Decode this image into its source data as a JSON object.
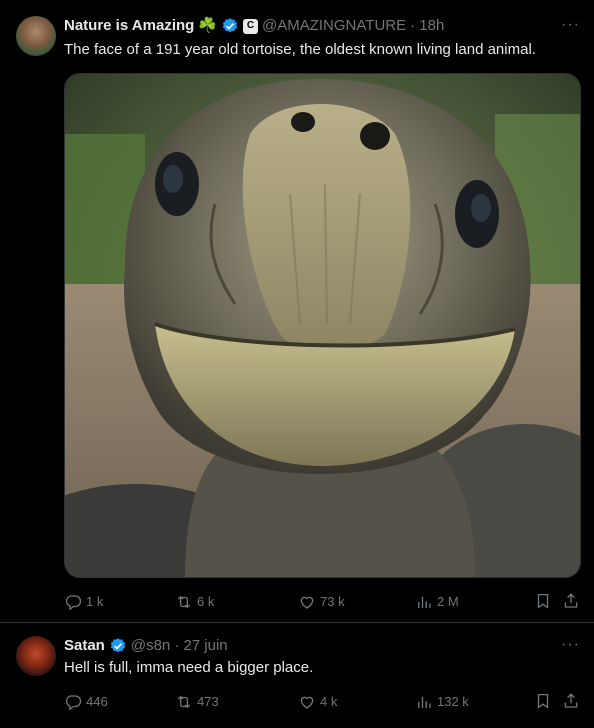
{
  "tweets": [
    {
      "name": "Nature is Amazing",
      "emoji": "☘️",
      "affiliate_badge": "C",
      "handle": "@AMAZINGNATURE",
      "time": "· 18h",
      "text": "The face of a 191 year old tortoise, the oldest known living land animal.",
      "stats": {
        "replies": "1 k",
        "retweets": "6 k",
        "likes": "73 k",
        "views": "2 M"
      }
    },
    {
      "name": "Satan",
      "handle": "@s8n",
      "time": "· 27 juin",
      "text": "Hell is full, imma need a bigger place.",
      "stats": {
        "replies": "446",
        "retweets": "473",
        "likes": "4 k",
        "views": "132 k"
      }
    }
  ],
  "more_label": "···",
  "colors": {
    "background": "#000000",
    "text": "#e7e9ea",
    "muted": "#71767b",
    "verified": "#1d9bf0",
    "border": "#2f3336"
  },
  "icons": [
    "reply-icon",
    "retweet-icon",
    "like-icon",
    "views-icon",
    "bookmark-icon",
    "share-icon",
    "verified-badge-icon"
  ]
}
